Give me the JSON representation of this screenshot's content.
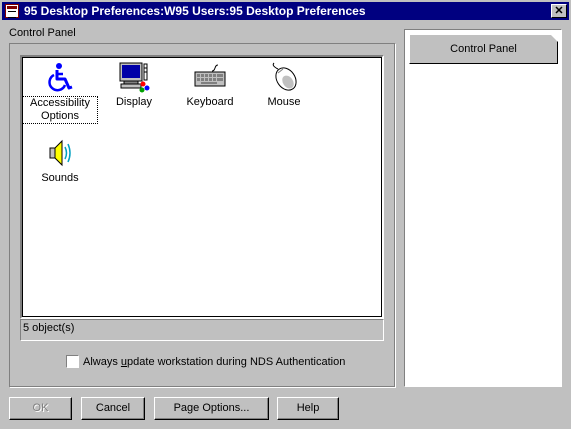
{
  "window": {
    "title": "95 Desktop Preferences:W95 Users:95 Desktop Preferences",
    "close_glyph": "✕"
  },
  "control_panel": {
    "group_label": "Control Panel",
    "items": [
      {
        "label": "Accessibility Options",
        "icon": "accessibility-icon"
      },
      {
        "label": "Display",
        "icon": "display-icon"
      },
      {
        "label": "Keyboard",
        "icon": "keyboard-icon"
      },
      {
        "label": "Mouse",
        "icon": "mouse-icon"
      },
      {
        "label": "Sounds",
        "icon": "sounds-icon"
      }
    ],
    "status": "5 object(s)"
  },
  "checkbox": {
    "label_pre": "Always ",
    "label_accel": "u",
    "label_post": "pdate workstation during NDS Authentication",
    "checked": false
  },
  "page_list": {
    "selected_tab": "Control Panel"
  },
  "buttons": {
    "ok": "OK",
    "cancel": "Cancel",
    "page_options": "Page Options...",
    "help": "Help"
  },
  "colors": {
    "titlebar": "#000080",
    "face": "#c0c0c0",
    "accessibility_blue": "#0000ff"
  }
}
